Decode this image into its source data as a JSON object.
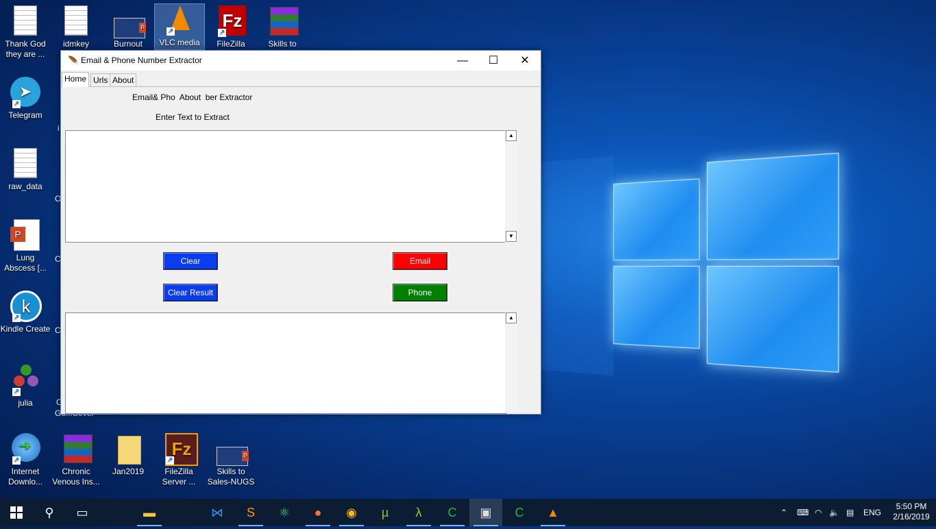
{
  "desktop": {
    "icons": [
      {
        "label": "Thank God they are ...",
        "icon": "document-icon"
      },
      {
        "label": "idmkey",
        "icon": "document-icon"
      },
      {
        "label": "Burnout",
        "icon": "powerpoint-icon"
      },
      {
        "label": "VLC media",
        "icon": "vlc-icon"
      },
      {
        "label": "FileZilla",
        "icon": "filezilla-icon"
      },
      {
        "label": "Skills to",
        "icon": "winrar-icon"
      },
      {
        "label": "Telegram",
        "icon": "telegram-icon"
      },
      {
        "label": "raw_data",
        "icon": "document-icon"
      },
      {
        "label": "Lung Abscess [...",
        "icon": "powerpoint-icon"
      },
      {
        "label": "Kindle Create",
        "icon": "kindle-icon"
      },
      {
        "label": "julia",
        "icon": "julia-icon"
      },
      {
        "label": "Internet Downlo...",
        "icon": "idm-icon"
      },
      {
        "label": "Chronic Venous Ins...",
        "icon": "winrar-icon"
      },
      {
        "label": "Jan2019",
        "icon": "folder-icon"
      },
      {
        "label": "FileZilla Server ...",
        "icon": "filezilla-icon"
      },
      {
        "label": "Skills to Sales-NUGS",
        "icon": "powerpoint-icon"
      }
    ],
    "hidden_fragments": [
      "i",
      "O",
      "C",
      "C",
      "C",
      "Go...Sever"
    ]
  },
  "window": {
    "title": "Email & Phone Number Extractor",
    "controls": {
      "minimize": "—",
      "maximize": "☐",
      "close": "✕"
    },
    "tabs": [
      "Home",
      "Urls",
      "About"
    ],
    "heading": "Email& Pho  About  ber Extractor",
    "enter_label": "Enter Text to Extract",
    "input_text": "",
    "result_text": "",
    "buttons": {
      "clear": "Clear",
      "clear_result": "Clear Result",
      "email": "Email",
      "phone": "Phone"
    },
    "colors": {
      "clear": "#0a3cf0",
      "email": "#ff0000",
      "phone": "#008000"
    }
  },
  "taskbar": {
    "tray": {
      "language": "ENG",
      "time": "5:50 PM",
      "date": "2/16/2019"
    }
  }
}
